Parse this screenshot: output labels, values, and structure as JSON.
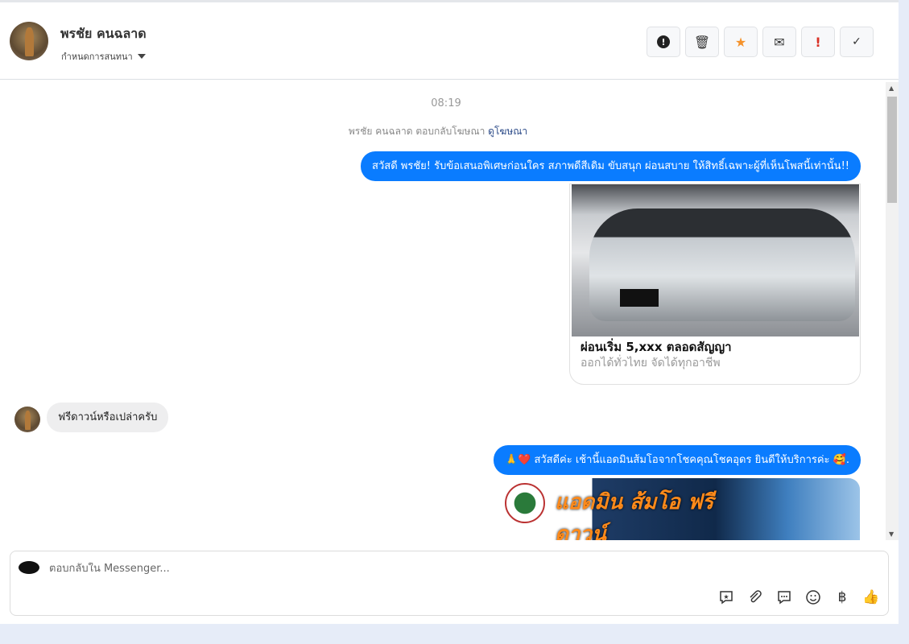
{
  "header": {
    "contact_name": "พรชัย คนฉลาด",
    "assign_label": "กำหนดการสนทนา",
    "actions": [
      {
        "icon": "alert-circle-icon",
        "label": "Spam"
      },
      {
        "icon": "trash-icon",
        "label": "Delete"
      },
      {
        "icon": "star-icon",
        "label": "Star",
        "color": "#f5922b"
      },
      {
        "icon": "envelope-icon",
        "label": "Mark unread"
      },
      {
        "icon": "exclamation-icon",
        "label": "Follow up",
        "color": "#d93025"
      },
      {
        "icon": "check-icon",
        "label": "Done"
      }
    ]
  },
  "thread": {
    "time": "08:19",
    "ad_reply_text": "พรชัย คนฉลาด ตอบกลับโฆษณา",
    "ad_link": "ดูโฆษณา",
    "messages": [
      {
        "text": "สวัสดี พรชัย! รับข้อเสนอพิเศษก่อนใคร สภาพดีสีเดิม ขับสนุก ผ่อนสบาย ให้สิทธิ์เฉพาะผู้ที่เห็นโพสนี้เท่านั้น!!"
      },
      {
        "card_title": "ผ่อนเริ่ม 5,xxx ตลอดสัญญา",
        "card_subtitle": "ออกได้ทั่วไทย จัดได้ทุกอาชีพ"
      },
      {
        "text": "ฟรีดาวน์หรือเปล่าครับ"
      },
      {
        "text": "🙏❤️ สวัสดีค่ะ เช้านี้แอดมินส้มโอจากโชคคุณโชคอุดร ยินดีให้บริการค่ะ 🥰."
      },
      {
        "banner_text": "แอดมิน ส้มโอ ฟรีดาวน์"
      }
    ],
    "accent_color": "#0a7cff"
  },
  "composer": {
    "placeholder": "ตอบกลับใน Messenger...",
    "tools": [
      "saved-reply-icon",
      "paperclip-icon",
      "chat-bubble-icon",
      "emoji-icon",
      "baht-icon",
      "thumbs-up-icon"
    ]
  }
}
